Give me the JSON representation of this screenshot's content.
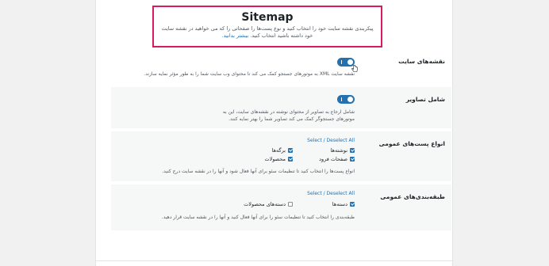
{
  "header": {
    "title": "Sitemap",
    "description": "پیکربندی نقشه سایت خود را انتخاب کنید و نوع پست‌ها را صفحاتی را که می خواهید در نقشه سایت خود داشته باشید انتخاب کنید.",
    "learn_more": "بیشتر بدانید."
  },
  "sitemaps": {
    "title": "نقشه‌های سایت",
    "toggle_on": true,
    "description": "نقشه سایت XML به موتورهای جستجو کمک می کند تا محتوای وب سایت شما را به طور مؤثر نمایه سازند."
  },
  "images": {
    "title": "شامل تصاویر",
    "toggle_on": true,
    "description": "شامل ارجاع به تصاویر از محتوای نوشته در نقشه‌های سایت، این به موتورهای جستجوگر کمک می کند تصاویر شما را بهتر نمایه کنند."
  },
  "post_types": {
    "title": "انواع پست‌های عمومی",
    "select_link": "Select / Deselect All",
    "options": [
      {
        "label": "نوشته‌ها",
        "checked": true
      },
      {
        "label": "برگه‌ها",
        "checked": true
      },
      {
        "label": "صفحات فرود",
        "checked": true
      },
      {
        "label": "محصولات",
        "checked": true
      }
    ],
    "description": "انواع پست‌ها را انتخاب کنید تا تنظیمات سئو برای آنها فعال شود و آنها را در نقشه سایت درج کنید."
  },
  "taxonomies": {
    "title": "طبقه‌بندی‌های عمومی",
    "select_link": "Select / Deselect All",
    "options": [
      {
        "label": "دسته‌ها",
        "checked": true
      },
      {
        "label": "دسته‌های محصولات",
        "checked": false
      }
    ],
    "description": "طبقه‌بندی را انتخاب کنید تا تنظیمات سئو را برای آنها فعال کنید و آنها را در نقشه سایت قرار دهید."
  },
  "colors": {
    "accent": "#2271b1",
    "highlight_border": "#d81b60",
    "shaded_bg": "#f6f7f7"
  }
}
